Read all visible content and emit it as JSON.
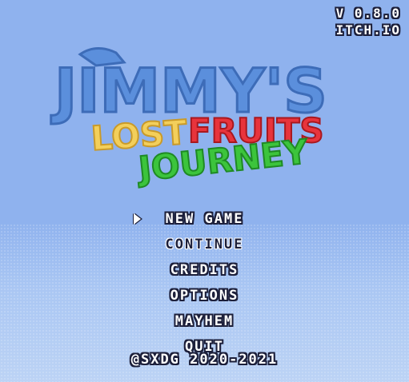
{
  "version": {
    "line1": "V 0.8.0",
    "line2": "ITCH.IO"
  },
  "logo": {
    "word1": "JIMMY'S",
    "word2": "LOST",
    "word3": "FRUITS",
    "word4": "JOURNEY",
    "colors": {
      "word1": "#5b8fdc",
      "word2": "#f3cf5b",
      "word3": "#e8343c",
      "word4": "#3cc43c"
    }
  },
  "menu": {
    "selected_index": 0,
    "items": [
      {
        "label": "NEW GAME"
      },
      {
        "label": "CONTINUE"
      },
      {
        "label": "CREDITS"
      },
      {
        "label": "OPTIONS"
      },
      {
        "label": "MAYHEM"
      },
      {
        "label": "QUIT"
      }
    ]
  },
  "footer": {
    "copyright": "@SXDG 2020-2021"
  }
}
